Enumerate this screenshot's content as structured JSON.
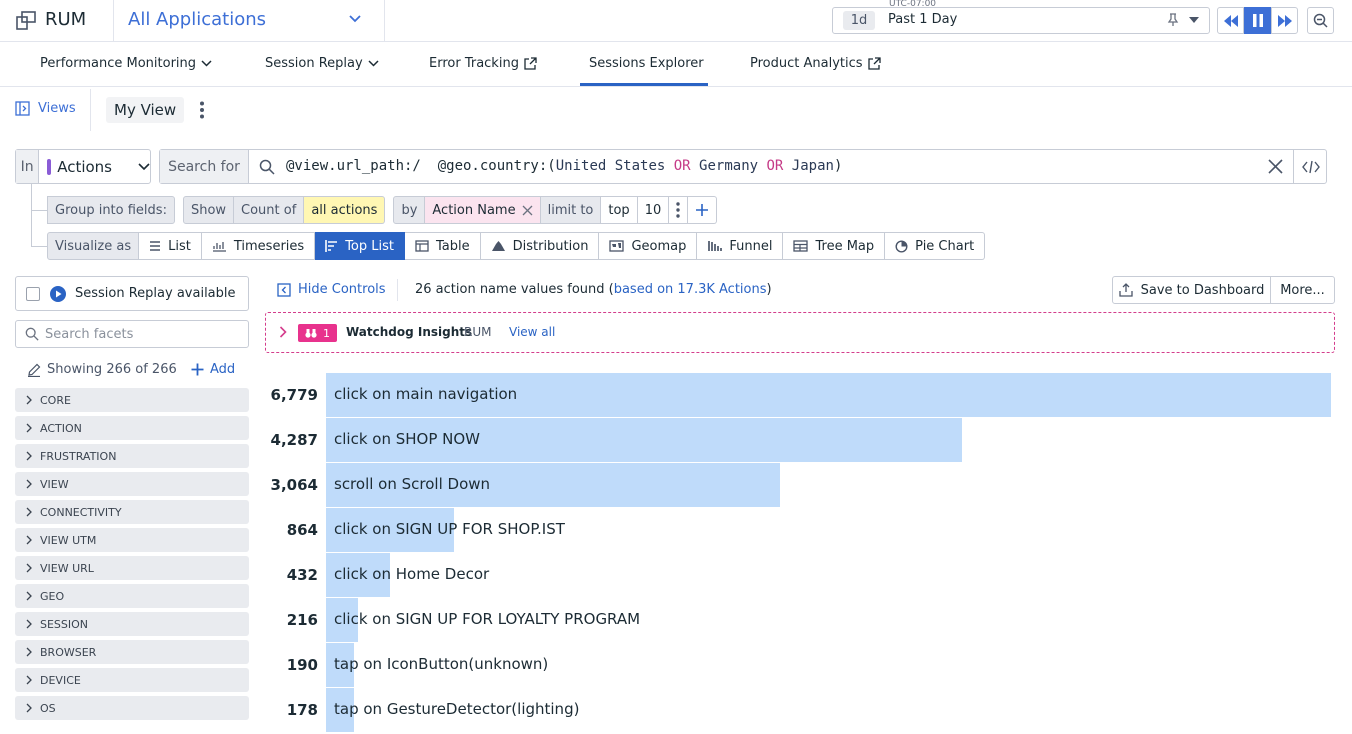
{
  "header": {
    "product": "RUM",
    "app_selector": "All Applications",
    "timezone": "UTC-07:00",
    "time_chip": "1d",
    "time_range": "Past 1 Day"
  },
  "nav": {
    "tabs": [
      {
        "label": "Performance Monitoring",
        "icon": "chevron-down-icon"
      },
      {
        "label": "Session Replay",
        "icon": "chevron-down-icon"
      },
      {
        "label": "Error Tracking",
        "icon": "external-link-icon"
      },
      {
        "label": "Sessions Explorer",
        "active": true
      },
      {
        "label": "Product Analytics",
        "icon": "external-link-icon"
      }
    ]
  },
  "views": {
    "views_label": "Views",
    "current_view": "My View"
  },
  "query": {
    "in_label": "In",
    "in_value": "Actions",
    "search_label": "Search for",
    "q1_attr": "@view.url_path:/",
    "q2_attr": "@geo.country:(",
    "q2_v1": "United States",
    "op1": "OR",
    "q2_v2": "Germany",
    "op2": "OR",
    "q2_v3": "Japan",
    "q2_close": ")"
  },
  "group": {
    "label": "Group into fields:",
    "show": "Show",
    "count_of": "Count of",
    "measure": "all actions",
    "by": "by",
    "field": "Action Name",
    "limit_to": "limit to",
    "order": "top",
    "limit": "10"
  },
  "visualize": {
    "label": "Visualize as",
    "options": [
      "List",
      "Timeseries",
      "Top List",
      "Table",
      "Distribution",
      "Geomap",
      "Funnel",
      "Tree Map",
      "Pie Chart"
    ],
    "active": "Top List"
  },
  "facets": {
    "session_replay_label": "Session Replay available",
    "search_placeholder": "Search facets",
    "showing": "Showing 266 of 266",
    "add_label": "Add",
    "groups": [
      "CORE",
      "ACTION",
      "FRUSTRATION",
      "VIEW",
      "CONNECTIVITY",
      "VIEW UTM",
      "VIEW URL",
      "GEO",
      "SESSION",
      "BROWSER",
      "DEVICE",
      "OS"
    ]
  },
  "results": {
    "hide_controls": "Hide Controls",
    "count_text": "26 action name values found (",
    "count_link": "based on 17.3K Actions",
    "count_close": ")",
    "save_label": "Save to Dashboard",
    "more_label": "More..."
  },
  "watchdog": {
    "count": "1",
    "title": "Watchdog Insights",
    "product": "RUM",
    "view_all": "View all"
  },
  "colors": {
    "accent": "#2a63c4",
    "bar": "#bfdbfa",
    "watchdog": "#e8328d"
  },
  "chart_data": {
    "type": "bar",
    "orientation": "horizontal",
    "categories": [
      "click on main navigation",
      "click on SHOP NOW",
      "scroll on Scroll Down",
      "click on SIGN UP FOR SHOP.IST",
      "click on Home Decor",
      "click on SIGN UP FOR LOYALTY PROGRAM",
      "tap on IconButton(unknown)",
      "tap on GestureDetector(lighting)"
    ],
    "values": [
      6779,
      4287,
      3064,
      864,
      432,
      216,
      190,
      178
    ],
    "value_labels": [
      "6,779",
      "4,287",
      "3,064",
      "864",
      "432",
      "216",
      "190",
      "178"
    ]
  }
}
